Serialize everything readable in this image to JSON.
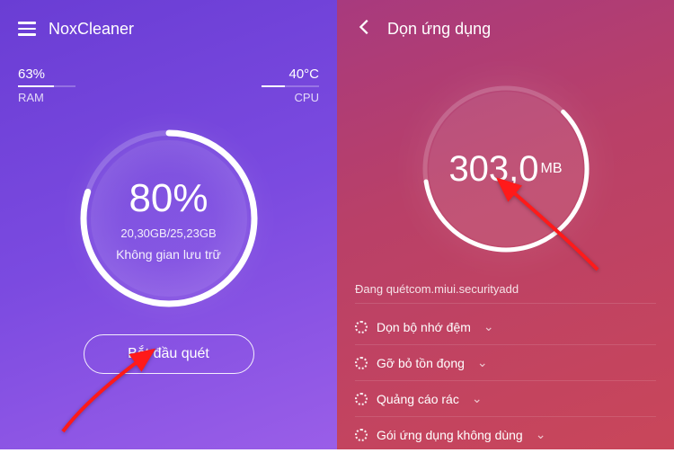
{
  "left": {
    "app_title": "NoxCleaner",
    "ram_value": "63%",
    "ram_label": "RAM",
    "ram_fill_pct": 63,
    "cpu_value": "40°C",
    "cpu_label": "CPU",
    "cpu_fill_pct": 40,
    "storage_pct": "80%",
    "storage_ratio": "20,30GB/25,23GB",
    "storage_label": "Không gian lưu trữ",
    "ring_progress_pct": 80,
    "scan_button": "Bắt đầu quét"
  },
  "right": {
    "title": "Dọn ứng dụng",
    "size_value": "303,0",
    "size_unit": "MB",
    "ring_progress_pct": 60,
    "status": "Đang quétcom.miui.securityadd",
    "items": [
      {
        "label": "Dọn bộ nhớ đệm"
      },
      {
        "label": "Gỡ bỏ tồn đọng"
      },
      {
        "label": "Quảng cáo rác"
      },
      {
        "label": "Gói ứng dụng không dùng"
      }
    ]
  },
  "colors": {
    "arrow": "#ff1a1a"
  }
}
